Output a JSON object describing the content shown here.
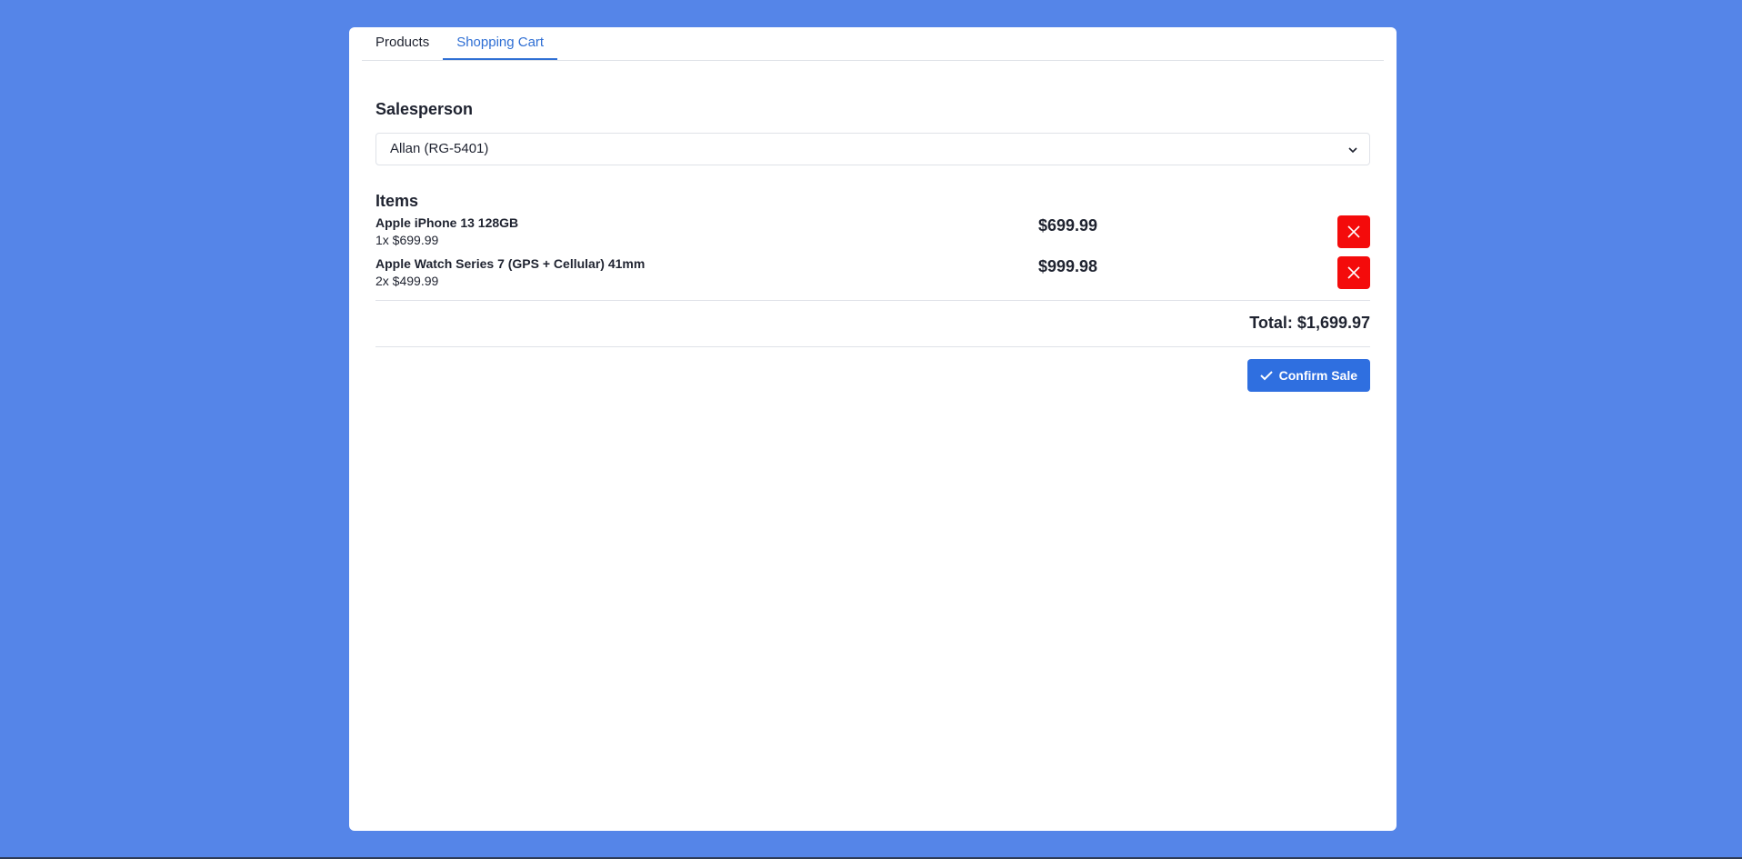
{
  "tabs": [
    {
      "label": "Products",
      "active": false
    },
    {
      "label": "Shopping Cart",
      "active": true
    }
  ],
  "salesperson": {
    "title": "Salesperson",
    "selected": "Allan (RG-5401)"
  },
  "items": {
    "title": "Items",
    "list": [
      {
        "name": "Apple iPhone 13 128GB",
        "qty_price": "1x $699.99",
        "total": "$699.99"
      },
      {
        "name": "Apple Watch Series 7 (GPS + Cellular) 41mm",
        "qty_price": "2x $499.99",
        "total": "$999.98"
      }
    ]
  },
  "total": "Total: $1,699.97",
  "confirm_label": "Confirm Sale",
  "colors": {
    "background": "#5585e8",
    "accent": "#2f6fe0",
    "danger": "#f40b0b"
  },
  "icons": {
    "remove": "close-icon",
    "confirm": "check-icon",
    "select": "chevron-down-icon"
  }
}
